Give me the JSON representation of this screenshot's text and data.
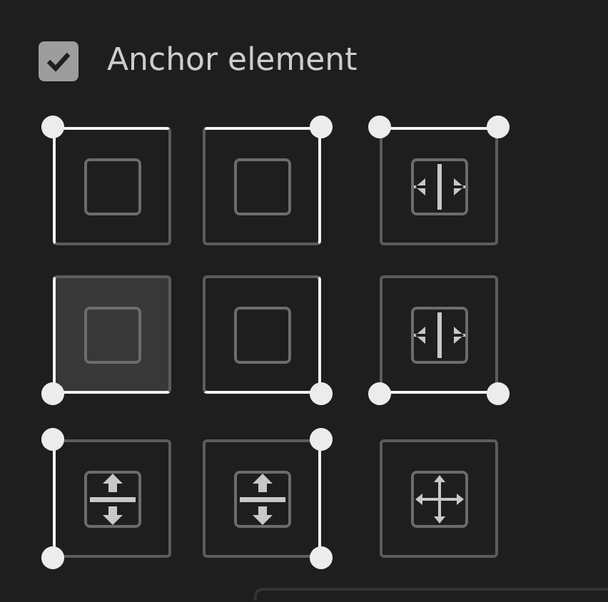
{
  "anchor_element": {
    "label": "Anchor element",
    "checked": true
  },
  "presets": [
    {
      "kind": "top_left",
      "selected": false
    },
    {
      "kind": "top_right",
      "selected": false
    },
    {
      "kind": "top_stretch",
      "selected": false
    },
    {
      "kind": "bottom_left",
      "selected": true
    },
    {
      "kind": "bottom_right",
      "selected": false
    },
    {
      "kind": "bottom_stretch",
      "selected": false
    },
    {
      "kind": "left_stretch",
      "selected": false
    },
    {
      "kind": "right_stretch",
      "selected": false
    },
    {
      "kind": "stretch",
      "selected": false
    }
  ]
}
